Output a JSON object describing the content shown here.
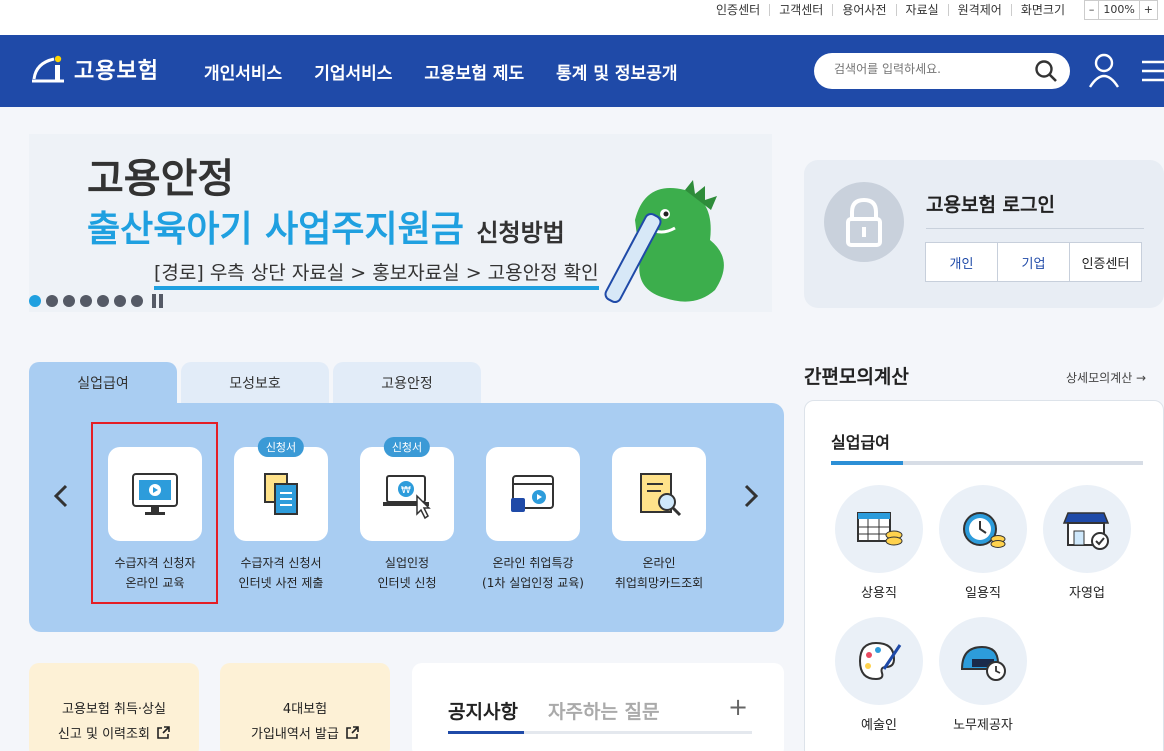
{
  "util_links": [
    "인증센터",
    "고객센터",
    "용어사전",
    "자료실",
    "원격제어",
    "화면크기"
  ],
  "zoom": {
    "minus": "–",
    "value": "100%",
    "plus": "+"
  },
  "logo": {
    "text": "고용보험"
  },
  "gnb_menu": [
    "개인서비스",
    "기업서비스",
    "고용보험 제도",
    "통계 및 정보공개"
  ],
  "search": {
    "placeholder": "검색어를 입력하세요."
  },
  "banner": {
    "line1": "고용안정",
    "line2_main": "출산육아기 사업주지원금",
    "line2_sub": "신청방법",
    "line3": "[경로] 우측 상단 자료실 > 홍보자료실 > 고용안정 확인",
    "slide_count": 7,
    "active_slide": 1
  },
  "login": {
    "title": "고용보험 로그인",
    "buttons": [
      "개인",
      "기업",
      "인증센터"
    ]
  },
  "tabs": [
    "실업급여",
    "모성보호",
    "고용안정"
  ],
  "active_tab": 0,
  "services": [
    {
      "line1": "수급자격 신청자",
      "line2": "온라인 교육",
      "badge": "",
      "icon": "monitor-play-icon"
    },
    {
      "line1": "수급자격 신청서",
      "line2": "인터넷 사전 제출",
      "badge": "신청서",
      "icon": "documents-icon"
    },
    {
      "line1": "실업인정",
      "line2": "인터넷 신청",
      "badge": "신청서",
      "icon": "laptop-click-icon"
    },
    {
      "line1": "온라인 취업특강",
      "line2": "(1차 실업인정 교육)",
      "badge": "",
      "icon": "video-window-icon"
    },
    {
      "line1": "온라인",
      "line2": "취업희망카드조회",
      "badge": "",
      "icon": "document-search-icon"
    }
  ],
  "quick_cards": [
    {
      "line1": "고용보험 취득·상실",
      "line2": "신고 및 이력조회"
    },
    {
      "line1": "4대보험",
      "line2": "가입내역서 발급"
    }
  ],
  "notice": {
    "tab1": "공지사항",
    "tab2": "자주하는 질문",
    "plus": "+"
  },
  "calc": {
    "title": "간편모의계산",
    "more": "상세모의계산 →",
    "subtitle": "실업급여",
    "jobs": [
      "상용직",
      "일용직",
      "자영업",
      "예술인",
      "노무제공자"
    ]
  },
  "colors": {
    "brand": "#1f4aa8",
    "accent": "#1fa0e0",
    "panel": "#a9cdf2",
    "highlight": "#e41e26"
  }
}
